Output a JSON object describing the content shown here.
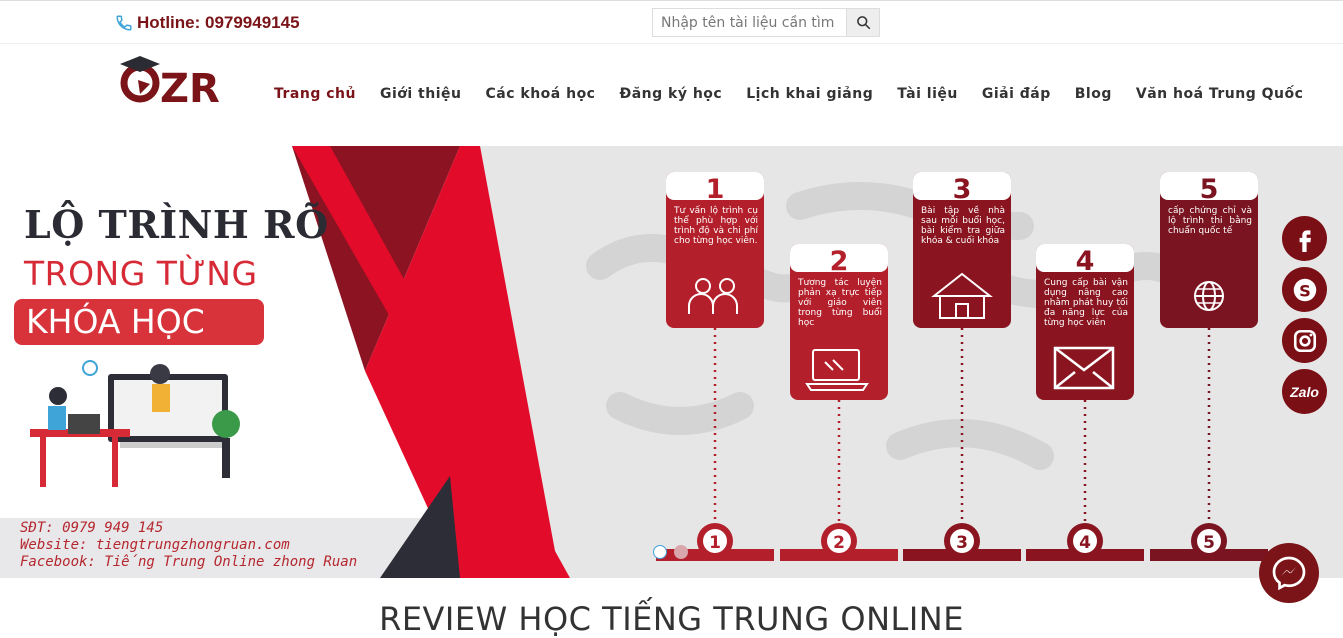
{
  "topbar": {
    "hotline": "Hotline: 0979949145",
    "search_placeholder": "Nhập tên tài liệu cần tìm"
  },
  "logo": {
    "text": "ZR"
  },
  "nav": {
    "items": [
      {
        "label": "Trang chủ"
      },
      {
        "label": "Giới thiệu"
      },
      {
        "label": "Các khoá học"
      },
      {
        "label": "Đăng ký học"
      },
      {
        "label": "Lịch khai giảng"
      },
      {
        "label": "Tài liệu"
      },
      {
        "label": "Giải đáp"
      },
      {
        "label": "Blog"
      },
      {
        "label": "Văn hoá Trung Quốc"
      }
    ]
  },
  "banner": {
    "title_1": "LỘ TRÌNH RÕ",
    "title_2": "TRONG TỪNG",
    "title_3": "KHÓA HỌC",
    "contact": {
      "phone": "SĐT: 0979 949 145",
      "website": "Website: tiengtrungzhongruan.com",
      "facebook": "Facebook: Tiếng Trung Online zhong Ruan"
    },
    "steps": [
      {
        "num": "1",
        "text": "Tư vấn lộ trình cụ thể phù hợp với trình độ và chi phí cho từng học viên.",
        "icon": "people-icon"
      },
      {
        "num": "2",
        "text": "Tương tác luyện phản xạ trực tiếp với giáo viên trong từng buổi học",
        "icon": "laptop-icon"
      },
      {
        "num": "3",
        "text": "Bài tập về nhà sau mỗi buổi học, bài kiểm tra giữa khóa & cuối khóa",
        "icon": "house-icon"
      },
      {
        "num": "4",
        "text": "Cung cấp bài vận dụng nâng cao nhằm phát huy tối đa năng lực của từng học viên",
        "icon": "envelope-icon"
      },
      {
        "num": "5",
        "text": "cấp chứng chỉ và lộ trình thi bằng chuẩn quốc tế",
        "icon": "globe-icon"
      }
    ],
    "active_slide": 1,
    "slide_count": 2
  },
  "socials": {
    "zalo": "Zalo"
  },
  "review": {
    "heading": "REVIEW HỌC TIẾNG TRUNG ONLINE"
  },
  "colors": {
    "brand": "#7a1418",
    "accent_red": "#e30b2a",
    "card_dark": "#8a1520",
    "card_red": "#b3202b"
  }
}
